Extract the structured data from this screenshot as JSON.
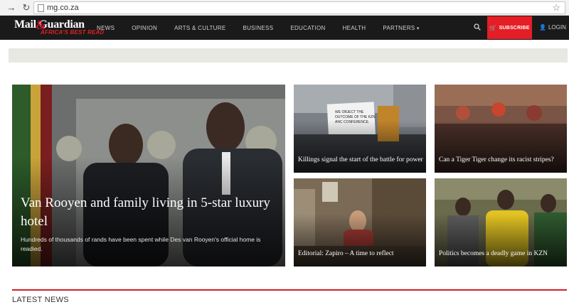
{
  "browser": {
    "url": "mg.co.za"
  },
  "site": {
    "logo_text": "Mail Guardian",
    "logo_tagline": "AFRICA'S BEST READ",
    "nav": [
      "NEWS",
      "OPINION",
      "ARTS & CULTURE",
      "BUSINESS",
      "EDUCATION",
      "HEALTH",
      "PARTNERS"
    ],
    "subscribe_label": "SUBSCRIBE",
    "login_label": "LOGIN",
    "accent_color": "#e51e25"
  },
  "featured": {
    "title": "Van Rooyen and family living in 5-star luxury hotel",
    "summary": "Hundreds of thousands of rands have been spent while Des van Rooyen's official home is readied."
  },
  "stories": [
    {
      "title": "Killings signal the start of the battle for power"
    },
    {
      "title": "Can a Tiger Tiger change its racist stripes?"
    },
    {
      "title": "Editorial: Zapiro – A time to reflect"
    },
    {
      "title": "Politics becomes a deadly game in KZN"
    }
  ],
  "featured_protest_sign": "WE OBJECT THE OUTCOME OF THE KZN ANC CONFERENCE.",
  "latest_news_heading": "LATEST NEWS"
}
